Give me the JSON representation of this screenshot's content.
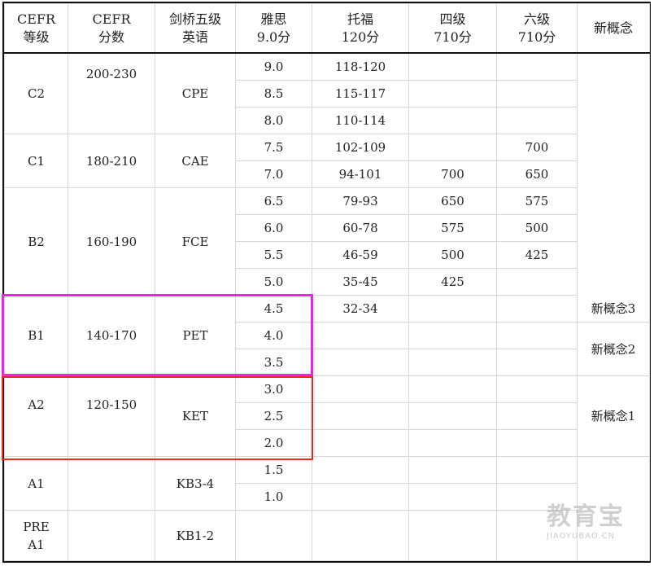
{
  "headers": [
    "CEFR\n等级",
    "CEFR\n分数",
    "剑桥五级\n英语",
    "雅思\n9.0分",
    "托福\n120分",
    "四级\n710分",
    "六级\n710分",
    "新概念"
  ],
  "groups": [
    {
      "level": "C2",
      "score": "200-230",
      "cambridge": "CPE"
    },
    {
      "level": "C1",
      "score": "180-210",
      "cambridge": "CAE"
    },
    {
      "level": "B2",
      "score": "160-190",
      "cambridge": "FCE"
    },
    {
      "level": "B1",
      "score": "140-170",
      "cambridge": "PET"
    },
    {
      "level": "A2",
      "score": "120-150",
      "cambridge": "KET"
    },
    {
      "level": "A1",
      "score": "",
      "cambridge": "KB3-4"
    },
    {
      "level": "PRE\nA1",
      "score": "",
      "cambridge": "KB1-2"
    }
  ],
  "ielts": [
    "9.0",
    "8.5",
    "8.0",
    "7.5",
    "7.0",
    "6.5",
    "6.0",
    "5.5",
    "5.0",
    "4.5",
    "4.0",
    "3.5",
    "3.0",
    "2.5",
    "2.0",
    "1.5",
    "1.0",
    ""
  ],
  "toefl": [
    "118-120",
    "115-117",
    "110-114",
    "102-109",
    "94-101",
    "79-93",
    "60-78",
    "46-59",
    "35-45",
    "32-34",
    "",
    "",
    "",
    "",
    "",
    "",
    "",
    ""
  ],
  "cet4": [
    "",
    "",
    "",
    "",
    "700",
    "650",
    "575",
    "500",
    "425",
    "",
    "",
    "",
    "",
    "",
    "",
    "",
    "",
    ""
  ],
  "cet6": [
    "",
    "",
    "",
    "700",
    "650",
    "575",
    "500",
    "425",
    "",
    "",
    "",
    "",
    "",
    "",
    "",
    "",
    "",
    ""
  ],
  "new_concept": [
    "",
    "新概念3",
    "新概念2",
    "新概念1",
    ""
  ],
  "watermark": {
    "main": "教育宝",
    "sub": "JIAOYUBAO.CN"
  },
  "highlight_colors": {
    "b1_box": "#ee22ee",
    "a2_box": "#ee2a1a"
  }
}
